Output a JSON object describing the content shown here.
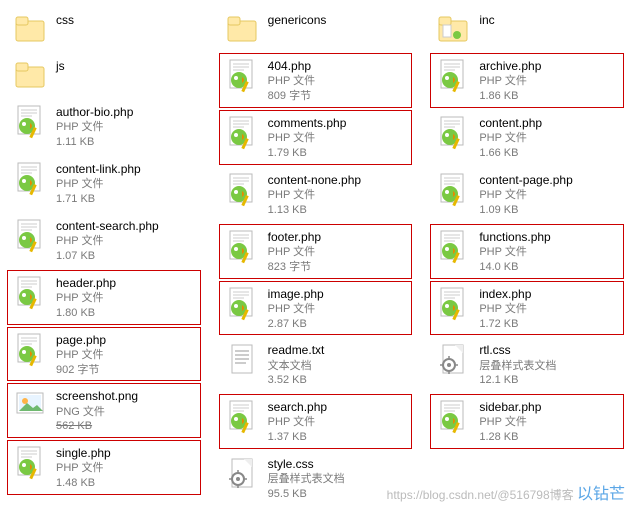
{
  "columns": [
    [
      {
        "name": "css",
        "type": "",
        "size": "",
        "icon": "folder",
        "boxed": false
      },
      {
        "name": "js",
        "type": "",
        "size": "",
        "icon": "folder",
        "boxed": false
      },
      {
        "name": "author-bio.php",
        "type": "PHP 文件",
        "size": "1.11 KB",
        "icon": "php",
        "boxed": false
      },
      {
        "name": "content-link.php",
        "type": "PHP 文件",
        "size": "1.71 KB",
        "icon": "php",
        "boxed": false
      },
      {
        "name": "content-search.php",
        "type": "PHP 文件",
        "size": "1.07 KB",
        "icon": "php",
        "boxed": false
      },
      {
        "name": "header.php",
        "type": "PHP 文件",
        "size": "1.80 KB",
        "icon": "php",
        "boxed": true
      },
      {
        "name": "page.php",
        "type": "PHP 文件",
        "size": "902 字节",
        "icon": "php",
        "boxed": true
      },
      {
        "name": "screenshot.png",
        "type": "PNG 文件",
        "size": "562 KB",
        "icon": "png",
        "boxed": true,
        "strike": true
      },
      {
        "name": "single.php",
        "type": "PHP 文件",
        "size": "1.48 KB",
        "icon": "php",
        "boxed": true
      }
    ],
    [
      {
        "name": "genericons",
        "type": "",
        "size": "",
        "icon": "folder",
        "boxed": false
      },
      {
        "name": "404.php",
        "type": "PHP 文件",
        "size": "809 字节",
        "icon": "php",
        "boxed": true
      },
      {
        "name": "comments.php",
        "type": "PHP 文件",
        "size": "1.79 KB",
        "icon": "php",
        "boxed": true
      },
      {
        "name": "content-none.php",
        "type": "PHP 文件",
        "size": "1.13 KB",
        "icon": "php",
        "boxed": false
      },
      {
        "name": "footer.php",
        "type": "PHP 文件",
        "size": "823 字节",
        "icon": "php",
        "boxed": true
      },
      {
        "name": "image.php",
        "type": "PHP 文件",
        "size": "2.87 KB",
        "icon": "php",
        "boxed": true
      },
      {
        "name": "readme.txt",
        "type": "文本文档",
        "size": "3.52 KB",
        "icon": "txt",
        "boxed": false
      },
      {
        "name": "search.php",
        "type": "PHP 文件",
        "size": "1.37 KB",
        "icon": "php",
        "boxed": true
      },
      {
        "name": "style.css",
        "type": "层叠样式表文档",
        "size": "95.5 KB",
        "icon": "css",
        "boxed": false
      }
    ],
    [
      {
        "name": "inc",
        "type": "",
        "size": "",
        "icon": "folder-open",
        "boxed": false
      },
      {
        "name": "archive.php",
        "type": "PHP 文件",
        "size": "1.86 KB",
        "icon": "php",
        "boxed": true
      },
      {
        "name": "content.php",
        "type": "PHP 文件",
        "size": "1.66 KB",
        "icon": "php",
        "boxed": false
      },
      {
        "name": "content-page.php",
        "type": "PHP 文件",
        "size": "1.09 KB",
        "icon": "php",
        "boxed": false
      },
      {
        "name": "functions.php",
        "type": "PHP 文件",
        "size": "14.0 KB",
        "icon": "php",
        "boxed": true
      },
      {
        "name": "index.php",
        "type": "PHP 文件",
        "size": "1.72 KB",
        "icon": "php",
        "boxed": true
      },
      {
        "name": "rtl.css",
        "type": "层叠样式表文档",
        "size": "12.1 KB",
        "icon": "css",
        "boxed": false
      },
      {
        "name": "sidebar.php",
        "type": "PHP 文件",
        "size": "1.28 KB",
        "icon": "php",
        "boxed": true
      }
    ]
  ],
  "watermark": "https://blog.csdn.net/@516798博客"
}
